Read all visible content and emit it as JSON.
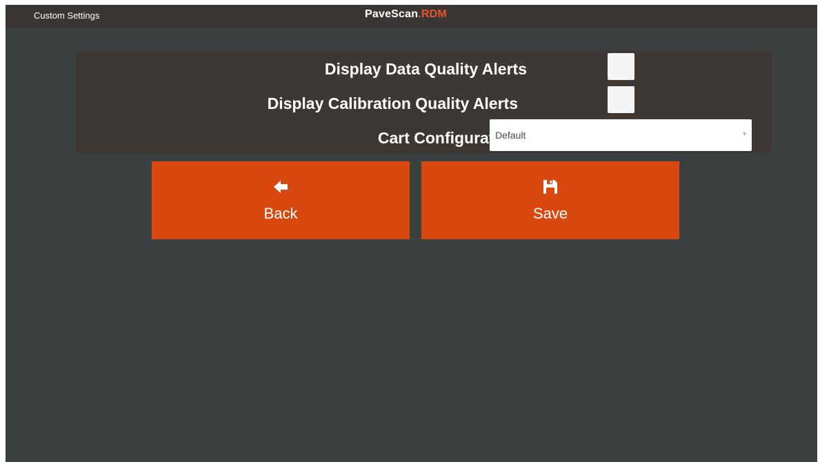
{
  "header": {
    "title": "Custom Settings",
    "brand_main": "PaveScan",
    "brand_dot": ".",
    "brand_accent": "RDM"
  },
  "settings": {
    "data_quality_alerts": {
      "label": "Display Data Quality Alerts",
      "checked": false
    },
    "calibration_quality_alerts": {
      "label": "Display Calibration Quality Alerts",
      "checked": false
    },
    "cart_configuration": {
      "label": "Cart Configuration",
      "value": "Default"
    }
  },
  "buttons": {
    "back": {
      "label": "Back",
      "icon": "arrow-left-icon"
    },
    "save": {
      "label": "Save",
      "icon": "floppy-disk-icon"
    }
  },
  "colors": {
    "background": "#3b4140",
    "header": "#3a3634",
    "panel": "#3e3835",
    "accent": "#d9480f",
    "brand_accent": "#e2562a"
  }
}
